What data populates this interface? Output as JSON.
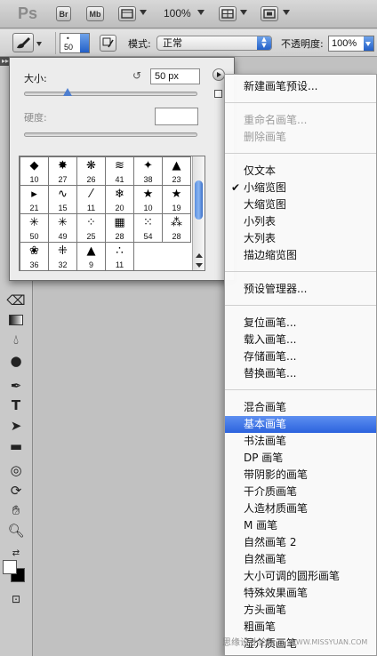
{
  "app_bar": {
    "logo": "Ps",
    "bridge_label": "Br",
    "minibridge_label": "Mb",
    "zoom_value": "100%"
  },
  "options_bar": {
    "brush_size": "50",
    "mode_label": "模式:",
    "mode_value": "正常",
    "opacity_label": "不透明度:",
    "opacity_value": "100%"
  },
  "brush_panel": {
    "size_label": "大小:",
    "size_value": "50 px",
    "size_fraction": 0.25,
    "hardness_label": "硬度:",
    "hardness_value": "",
    "presets": [
      {
        "shape": "◆",
        "size": "10"
      },
      {
        "shape": "✸",
        "size": "27"
      },
      {
        "shape": "❋",
        "size": "26"
      },
      {
        "shape": "≋",
        "size": "41"
      },
      {
        "shape": "✦",
        "size": "38"
      },
      {
        "shape": "▲",
        "size": "23"
      },
      {
        "shape": "▸",
        "size": "21"
      },
      {
        "shape": "∿",
        "size": "15"
      },
      {
        "shape": "⁄",
        "size": "11"
      },
      {
        "shape": "❄",
        "size": "20"
      },
      {
        "shape": "★",
        "size": "10"
      },
      {
        "shape": "★",
        "size": "19"
      },
      {
        "shape": "✳",
        "size": "50"
      },
      {
        "shape": "✳",
        "size": "49"
      },
      {
        "shape": "⁘",
        "size": "25"
      },
      {
        "shape": "▦",
        "size": "28"
      },
      {
        "shape": "⁙",
        "size": "54"
      },
      {
        "shape": "⁂",
        "size": "28"
      },
      {
        "shape": "❀",
        "size": "36"
      },
      {
        "shape": "⁜",
        "size": "32"
      },
      {
        "shape": "▲",
        "size": "9"
      },
      {
        "shape": "∴",
        "size": "11"
      }
    ]
  },
  "context_menu": {
    "items": [
      {
        "label": "新建画笔预设...",
        "disabled": false,
        "checked": false,
        "highlighted": false
      },
      {
        "label": "重命名画笔...",
        "disabled": true,
        "checked": false,
        "highlighted": false
      },
      {
        "label": "删除画笔",
        "disabled": true,
        "checked": false,
        "highlighted": false
      },
      {
        "label": "仅文本",
        "disabled": false,
        "checked": false,
        "highlighted": false
      },
      {
        "label": "小缩览图",
        "disabled": false,
        "checked": true,
        "highlighted": false
      },
      {
        "label": "大缩览图",
        "disabled": false,
        "checked": false,
        "highlighted": false
      },
      {
        "label": "小列表",
        "disabled": false,
        "checked": false,
        "highlighted": false
      },
      {
        "label": "大列表",
        "disabled": false,
        "checked": false,
        "highlighted": false
      },
      {
        "label": "描边缩览图",
        "disabled": false,
        "checked": false,
        "highlighted": false
      },
      {
        "label": "预设管理器...",
        "disabled": false,
        "checked": false,
        "highlighted": false
      },
      {
        "label": "复位画笔...",
        "disabled": false,
        "checked": false,
        "highlighted": false
      },
      {
        "label": "载入画笔...",
        "disabled": false,
        "checked": false,
        "highlighted": false
      },
      {
        "label": "存储画笔...",
        "disabled": false,
        "checked": false,
        "highlighted": false
      },
      {
        "label": "替换画笔...",
        "disabled": false,
        "checked": false,
        "highlighted": false
      },
      {
        "label": "混合画笔",
        "disabled": false,
        "checked": false,
        "highlighted": false
      },
      {
        "label": "基本画笔",
        "disabled": false,
        "checked": false,
        "highlighted": true
      },
      {
        "label": "书法画笔",
        "disabled": false,
        "checked": false,
        "highlighted": false
      },
      {
        "label": "DP 画笔",
        "disabled": false,
        "checked": false,
        "highlighted": false
      },
      {
        "label": "带阴影的画笔",
        "disabled": false,
        "checked": false,
        "highlighted": false
      },
      {
        "label": "干介质画笔",
        "disabled": false,
        "checked": false,
        "highlighted": false
      },
      {
        "label": "人造材质画笔",
        "disabled": false,
        "checked": false,
        "highlighted": false
      },
      {
        "label": "M 画笔",
        "disabled": false,
        "checked": false,
        "highlighted": false
      },
      {
        "label": "自然画笔 2",
        "disabled": false,
        "checked": false,
        "highlighted": false
      },
      {
        "label": "自然画笔",
        "disabled": false,
        "checked": false,
        "highlighted": false
      },
      {
        "label": "大小可调的圆形画笔",
        "disabled": false,
        "checked": false,
        "highlighted": false
      },
      {
        "label": "特殊效果画笔",
        "disabled": false,
        "checked": false,
        "highlighted": false
      },
      {
        "label": "方头画笔",
        "disabled": false,
        "checked": false,
        "highlighted": false
      },
      {
        "label": "粗画笔",
        "disabled": false,
        "checked": false,
        "highlighted": false
      },
      {
        "label": "湿介质画笔",
        "disabled": false,
        "checked": false,
        "highlighted": false
      }
    ]
  },
  "watermark": {
    "text": "思缘设计论坛",
    "url": "WWW.MISSYUAN.COM"
  },
  "colors": {
    "highlight": "#3a6fe0",
    "scroll_thumb": "#5a8fe0"
  }
}
